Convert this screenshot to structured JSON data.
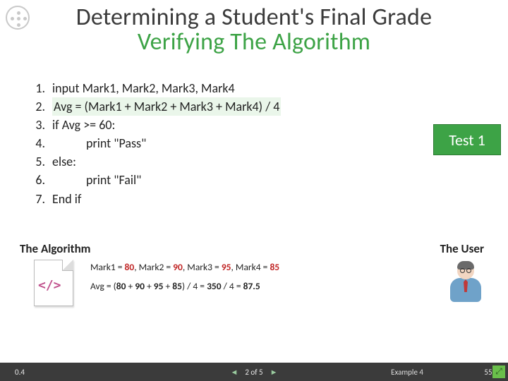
{
  "title": {
    "line1": "Determining a Student's Final Grade",
    "line2": "Verifying The Algorithm"
  },
  "algorithm": {
    "steps": [
      {
        "n": "1.",
        "text": "input Mark1, Mark2, Mark3, Mark4",
        "highlight": false,
        "indent": false
      },
      {
        "n": "2.",
        "text": "Avg = (Mark1 + Mark2 + Mark3 + Mark4) / 4",
        "highlight": true,
        "indent": false
      },
      {
        "n": "3.",
        "text": "if Avg >= 60:",
        "highlight": false,
        "indent": false
      },
      {
        "n": "4.",
        "text": "print \"Pass\"",
        "highlight": false,
        "indent": true
      },
      {
        "n": "5.",
        "text": "else:",
        "highlight": false,
        "indent": false
      },
      {
        "n": "6.",
        "text": "print \"Fail\"",
        "highlight": false,
        "indent": true
      },
      {
        "n": "7.",
        "text": "End if",
        "highlight": false,
        "indent": false
      }
    ]
  },
  "badge": "Test 1",
  "labels": {
    "algorithm": "The Algorithm",
    "user": "The User"
  },
  "code_icon_glyph": "</>",
  "calc": {
    "line1_parts": [
      "Mark1 = ",
      "80",
      ", Mark2 = ",
      "90",
      ", Mark3 = ",
      "95",
      ", Mark4 = ",
      "85"
    ],
    "line2_prefix": "Avg = (",
    "line2_vals": [
      "80",
      " + ",
      "90",
      " + ",
      "95",
      " + ",
      "85"
    ],
    "line2_mid": ") / 4 = ",
    "line2_sum": "350",
    "line2_mid2": " / 4 = ",
    "line2_result": "87.5"
  },
  "footer": {
    "version": "0.4",
    "pager": "2 of 5",
    "prev_glyph": "◄",
    "next_glyph": "►",
    "example": "Example 4",
    "page": "55",
    "expand_glyph": "⤢"
  }
}
